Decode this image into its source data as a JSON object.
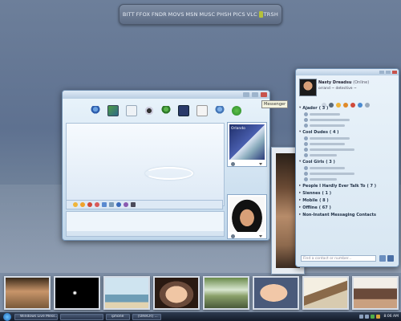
{
  "launcher": {
    "items": [
      "BITT",
      "FFOX",
      "FNDR",
      "MOVS",
      "MSN",
      "MUSC",
      "PHSH",
      "PICS",
      "VLC",
      "TRSH"
    ]
  },
  "chat_window": {
    "toolbar_icons": [
      "invite-icon",
      "send-files-icon",
      "webcam-icon",
      "video-call-icon",
      "call-icon",
      "games-icon",
      "activities-icon",
      "block-icon",
      "msn-icon"
    ],
    "tooltip": "Messenger",
    "contact_picture_caption": "Orlando"
  },
  "contact_list": {
    "user_name": "Nasty Dreadsu",
    "user_status": "(Online)",
    "personal_message": "orrand ~ detective ~",
    "groups": [
      {
        "name": "Ajador",
        "count": "( 3 )",
        "expanded": true,
        "contacts": 3
      },
      {
        "name": "Cool Dudes",
        "count": "( 4 )",
        "expanded": true,
        "contacts": 4
      },
      {
        "name": "Cool Girls",
        "count": "( 3 )",
        "expanded": true,
        "contacts": 3
      },
      {
        "name": "People I Hardly Ever Talk To",
        "count": "( 7 )",
        "expanded": false,
        "contacts": 0
      },
      {
        "name": "Siennes",
        "count": "( 1 )",
        "expanded": false,
        "contacts": 0
      },
      {
        "name": "Mobile",
        "count": "( 8 )",
        "expanded": false,
        "contacts": 0
      },
      {
        "name": "Offline",
        "count": "( 67 )",
        "expanded": false,
        "contacts": 0
      },
      {
        "name": "Non-Instant Messaging Contacts",
        "count": "",
        "expanded": false,
        "contacts": 0
      }
    ],
    "search_placeholder": "Find a contact or number..."
  },
  "taskbar": {
    "tasks": [
      "Windows Live Mess...",
      "",
      "iphone",
      "[OReCR] ..."
    ],
    "clock": "8:06 AM"
  },
  "colors": {
    "accent": "#6f8fb1",
    "launcher": "#6d7c94"
  }
}
